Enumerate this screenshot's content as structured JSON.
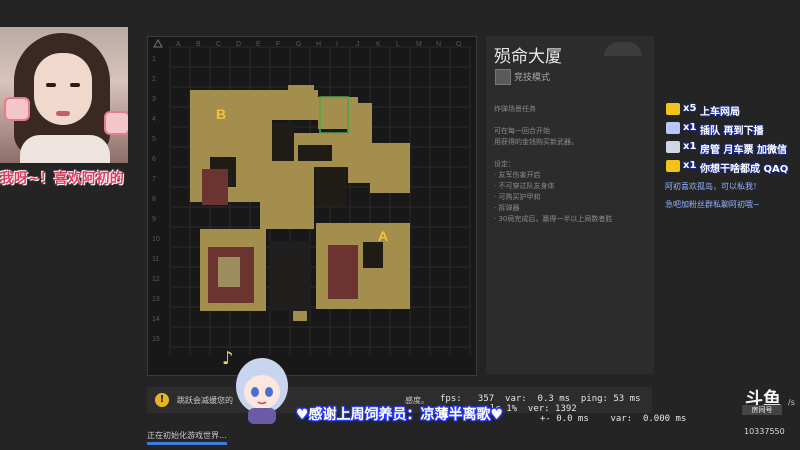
{
  "webcam_overlay": {
    "marquee_text": "我呀~！喜欢阿初的"
  },
  "map": {
    "columns": [
      "A",
      "B",
      "C",
      "D",
      "E",
      "F",
      "G",
      "H",
      "I",
      "J",
      "K",
      "L",
      "M",
      "N",
      "O"
    ],
    "rows": [
      "1",
      "2",
      "3",
      "4",
      "5",
      "6",
      "7",
      "8",
      "9",
      "10",
      "11",
      "12",
      "13",
      "14",
      "15"
    ],
    "site_a_label": "A",
    "site_b_label": "B"
  },
  "info": {
    "map_name": "殒命大厦",
    "mode": "竞技模式",
    "lines": [
      "炸弹场景任务",
      "",
      "可在每一回合开始",
      "用获得的金钱购买新武器。",
      "",
      "设定：",
      "· 友军伤害开启",
      "· 不可穿过队友身体",
      "· 可购买护甲和",
      "· 拆弹器",
      "· 30局完成后，赢得一半以上局数者胜"
    ]
  },
  "chat": {
    "messages": [
      {
        "icon": "gift-icon",
        "count": "x5",
        "text": "上车网局",
        "color": "#f0c419"
      },
      {
        "icon": "gift-icon",
        "count": "x1",
        "text": "插队  再到下播",
        "color": "#b8c7ff"
      },
      {
        "icon": "gift-icon",
        "count": "x1",
        "text": "房管  月车票  加微信",
        "color": "#cfd6e4"
      },
      {
        "icon": "gift-icon",
        "count": "x1",
        "text": "你想干啥都成 QAQ",
        "color": "#f0c419"
      }
    ],
    "small_1": "阿初喜欢孤岛，可以私我！",
    "small_2": "急吧加粉丝群私聊阿初哦~"
  },
  "notice": {
    "icon": "!",
    "text": "跳跃会减缓您的",
    "tail": "感度。"
  },
  "thanks_banner": "♥感谢上周饲养员：凉薄半离歌♥",
  "netgraph": {
    "line1": "fps:   357  var:  0.3 ms  ping: 53 ms",
    "line2": "lc 1%  ver: 1392",
    "line3": "+- 0.0 ms    var:  0.000 ms"
  },
  "loading_text": "正在初始化游戏世界...",
  "logo": {
    "brand": "斗鱼",
    "sub": "房间号",
    "room_id": "10337550",
    "edge_text": "/s"
  },
  "colors": {
    "map_floor": "#a38e4e",
    "site_red": "#6b3431",
    "chat_outline": "#1a2b8c",
    "marquee": "#e43a5c"
  }
}
